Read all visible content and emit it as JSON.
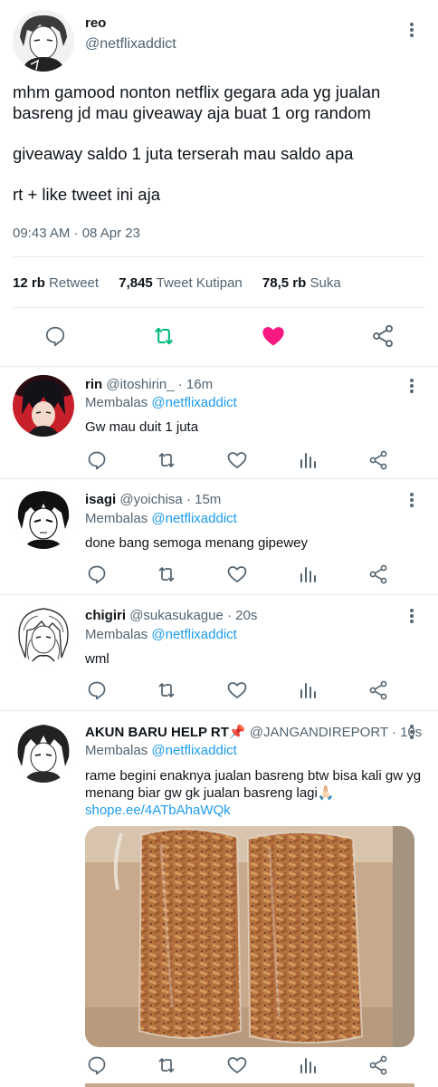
{
  "main_tweet": {
    "name": "reo",
    "handle": "@netflixaddict",
    "text_line1": "mhm gamood nonton netflix gegara ada yg jualan basreng jd mau giveaway aja buat 1 org random",
    "text_line2": "giveaway saldo 1 juta terserah mau saldo apa",
    "text_line3": "rt + like tweet ini aja",
    "timestamp": "09:43 AM · 08 Apr 23",
    "stats": {
      "retweets_count": "12 rb",
      "retweets_label": "Retweet",
      "quotes_count": "7,845",
      "quotes_label": "Tweet Kutipan",
      "likes_count": "78,5 rb",
      "likes_label": "Suka"
    }
  },
  "replies": [
    {
      "name": "rin",
      "handle": "@itoshirin_ · 16m",
      "replying_label": "Membalas",
      "replying_to": "@netflixaddict",
      "text": "Gw mau duit 1 juta"
    },
    {
      "name": "isagi",
      "handle": "@yoichisa · 15m",
      "replying_label": "Membalas",
      "replying_to": "@netflixaddict",
      "text": "done bang semoga menang gipewey"
    },
    {
      "name": "chigiri",
      "handle": "@sukasukague · 20s",
      "replying_label": "Membalas",
      "replying_to": "@netflixaddict",
      "text": "wml"
    },
    {
      "name": "AKUN BARU HELP RT📌",
      "handle": "@JANGANDIREPORT · 10s",
      "replying_label": "Membalas",
      "replying_to": "@netflixaddict",
      "text": "rame begini enaknya jualan basreng btw bisa kali gw yg menang biar gw gk jualan basreng lagi🙏🏻",
      "link": "shope.ee/4ATbAhaWQk"
    }
  ],
  "colors": {
    "text": "#0f1419",
    "secondary": "#536471",
    "link": "#1d9bf0",
    "retweet_green": "#00ba7c",
    "like_red": "#f91880",
    "divider": "#e6ecf0"
  },
  "icons": [
    "more-icon",
    "reply-icon",
    "retweet-icon",
    "like-icon",
    "analytics-icon",
    "share-icon"
  ]
}
